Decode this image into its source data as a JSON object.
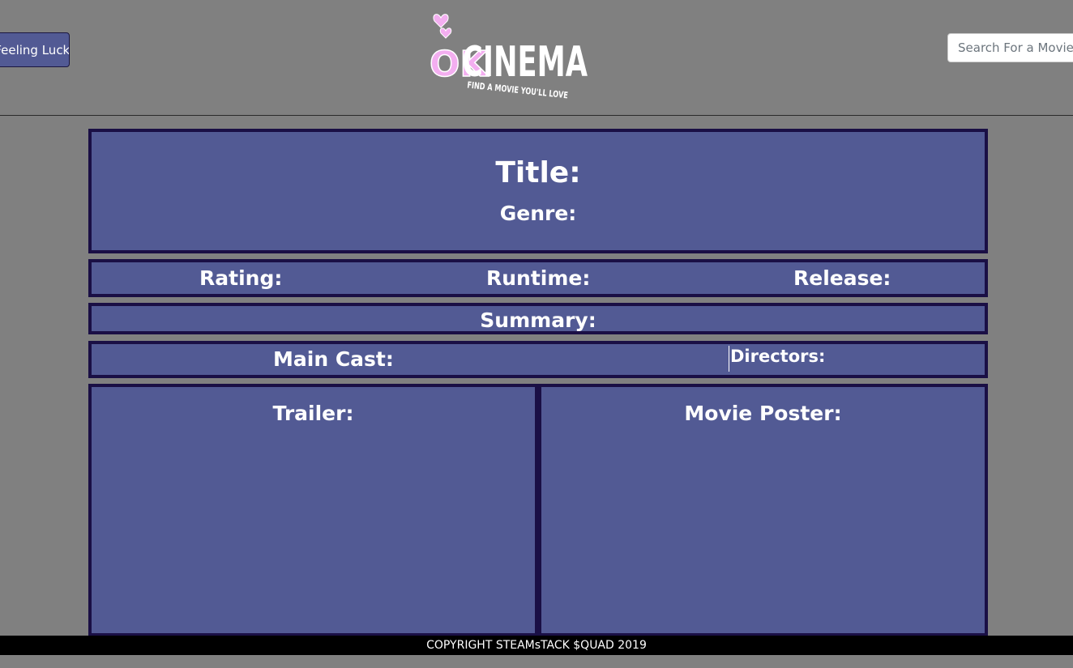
{
  "header": {
    "lucky_button": "I'm Feeling Lucky!",
    "search_placeholder": "Search For a Movie!",
    "logo": {
      "ok": "OK",
      "cinema": "CINEMA",
      "tagline": "FIND A MOVIE YOU'LL LOVE"
    }
  },
  "details": {
    "title_label": "Title:",
    "genre_label": "Genre:",
    "rating_label": "Rating:",
    "runtime_label": "Runtime:",
    "release_label": "Release:",
    "summary_label": "Summary:",
    "main_cast_label": "Main Cast:",
    "directors_label": "Directors:",
    "trailer_label": "Trailer:",
    "poster_label": "Movie Poster:"
  },
  "footer": {
    "copyright": "COPYRIGHT STEAMsTACK $QUAD 2019"
  },
  "colors": {
    "page_background": "#808080",
    "panel_fill": "#525a94",
    "panel_border": "#1a0f45",
    "logo_pink": "#f3aef0",
    "footer_background": "#000000"
  }
}
